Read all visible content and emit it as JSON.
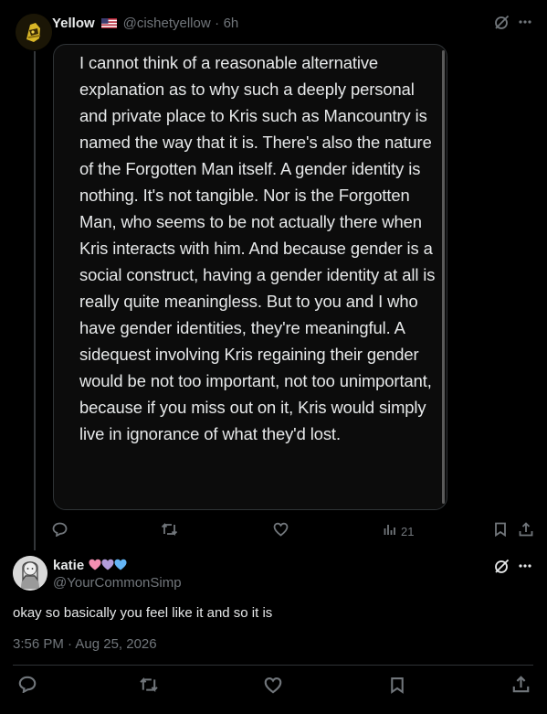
{
  "post": {
    "display_name": "Yellow",
    "flag_emoji": "🇺🇸",
    "handle": "@cishetyellow",
    "time_ago": "6h",
    "dot": "·",
    "quoted_text": "I cannot think of a reasonable alternative explanation as to why such a deeply personal and private place to Kris such as Mancountry is named the way that it is. There's also the nature of the Forgotten Man itself. A gender identity is nothing. It's not tangible. Nor is the Forgotten Man, who seems to be not actually there when Kris interacts with him. And because gender is a social construct, having a gender identity at all is really quite meaningless. But to you and I who have gender identities, they're meaningful. A sidequest involving Kris regaining their gender would be not too important, not too unimportant, because if you miss out on it, Kris would simply live in ignorance of what they'd lost.",
    "views": "21"
  },
  "reply": {
    "display_name": "katie",
    "heart_colors": [
      "#f48fb1",
      "#b39ddb",
      "#64b5f6"
    ],
    "handle": "@YourCommonSimp",
    "text": "okay so basically you feel like it and so it is",
    "timestamp": "3:56 PM · Aug 25, 2026"
  },
  "colors": {
    "background": "#000000",
    "text": "#e7e9ea",
    "muted": "#71767b",
    "border": "#2f3336"
  },
  "icons": [
    "grok-icon",
    "more-icon",
    "reply-icon",
    "retweet-icon",
    "like-icon",
    "views-icon",
    "bookmark-icon",
    "share-icon"
  ]
}
